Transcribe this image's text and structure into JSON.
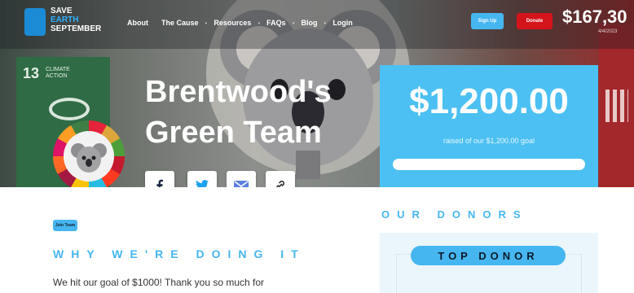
{
  "brand": {
    "line1": "SAVE",
    "line2": "EARTH",
    "line3": "SEPTEMBER"
  },
  "nav": {
    "items": [
      "About",
      "The Cause",
      "Resources",
      "FAQs",
      "Blog",
      "Login"
    ],
    "separator": "•",
    "signup_label": "Sign Up",
    "donate_label": "Donate",
    "total_raised": "$167,30",
    "date": "4/4/2023"
  },
  "hero": {
    "background_tiles": {
      "green_number": "13",
      "green_text": "CLIMATE ACTION"
    },
    "team_name_line1": "Brentwood's",
    "team_name_line2": "Green Team"
  },
  "fundraising": {
    "amount_raised": "$1,200.00",
    "goal_text": "raised of our $1,200.00 goal",
    "progress_fraction": 1.0
  },
  "share_icons": [
    "facebook-icon",
    "twitter-icon",
    "email-icon",
    "link-icon"
  ],
  "content": {
    "join_label": "Join Team",
    "why_title": "WHY WE'RE DOING IT",
    "body_text": "We hit our goal of $1000! Thank you so much for",
    "donors_title": "OUR DONORS",
    "top_donor_label": "TOP DONOR"
  },
  "colors": {
    "accent": "#46b6f0",
    "donate": "#d4141b",
    "card": "#4cc0f2"
  }
}
